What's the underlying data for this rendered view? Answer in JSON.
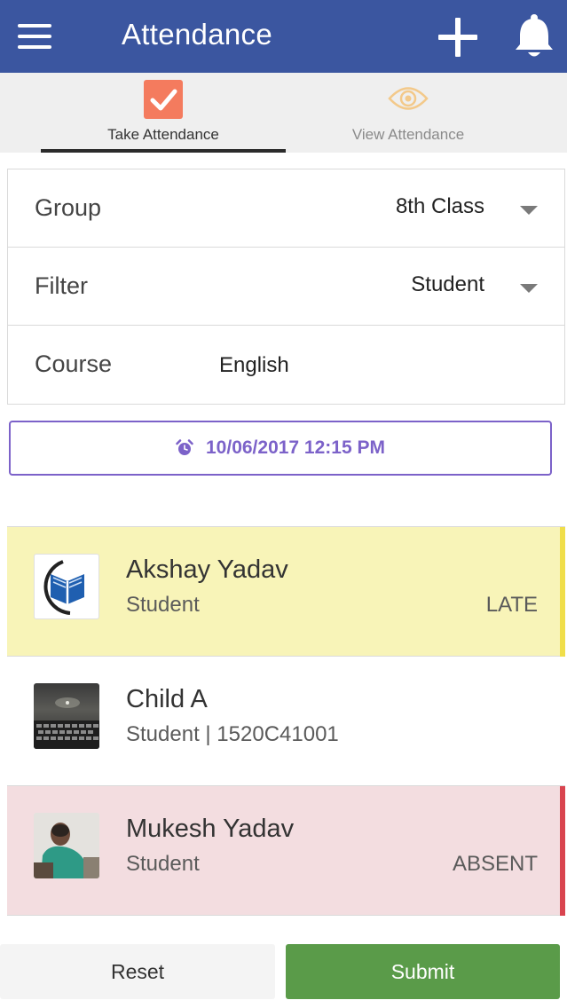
{
  "header": {
    "title": "Attendance",
    "bar_color": "#3b56a0",
    "menu_icon": "hamburger-menu-icon",
    "add_icon": "plus-icon",
    "notify_icon": "bell-icon"
  },
  "tabs": [
    {
      "label": "Take Attendance",
      "icon": "checkbox-checked-icon",
      "active": true
    },
    {
      "label": "View Attendance",
      "icon": "eye-icon",
      "active": false
    }
  ],
  "form": {
    "group": {
      "label": "Group",
      "value": "8th Class"
    },
    "filter": {
      "label": "Filter",
      "value": "Student"
    },
    "course": {
      "label": "Course",
      "value": "English"
    }
  },
  "datetime": {
    "icon": "alarm-clock-icon",
    "value": "10/06/2017 12:15 PM",
    "accent": "#7c62c9"
  },
  "students": [
    {
      "name": "Akshay Yadav",
      "subtitle": "Student",
      "status": "LATE",
      "bg": "#f8f4b8",
      "stripe": "#f0de4a",
      "avatar": "book-logo-avatar"
    },
    {
      "name": "Child A",
      "subtitle": "Student | 1520C41001",
      "status": "",
      "bg": "#ffffff",
      "stripe": "",
      "avatar": "keyboard-photo-avatar"
    },
    {
      "name": "Mukesh Yadav",
      "subtitle": "Student",
      "status": "ABSENT",
      "bg": "#f3dde0",
      "stripe": "#d9444f",
      "avatar": "person-photo-avatar"
    }
  ],
  "actions": {
    "reset_label": "Reset",
    "submit_label": "Submit",
    "submit_color": "#5a9b49"
  }
}
